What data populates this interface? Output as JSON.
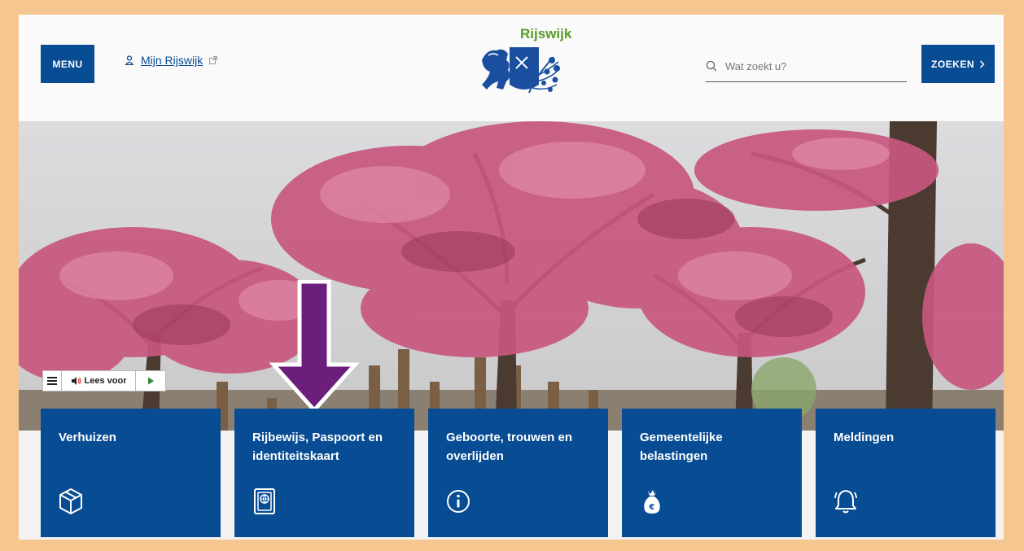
{
  "header": {
    "menu_label": "MENU",
    "mijn_label": "Mijn Rijswijk",
    "logo_text": "Rijswijk",
    "search_placeholder": "Wat zoekt u?",
    "search_button_label": "ZOEKEN"
  },
  "readspeaker": {
    "label": "Lees voor"
  },
  "tiles": [
    {
      "label": "Verhuizen",
      "icon": "box-icon"
    },
    {
      "label": "Rijbewijs, Paspoort en identiteitskaart",
      "icon": "passport-icon"
    },
    {
      "label": "Geboorte, trouwen en overlijden",
      "icon": "info-icon"
    },
    {
      "label": "Gemeentelijke belastingen",
      "icon": "money-bag-icon"
    },
    {
      "label": "Meldingen",
      "icon": "bell-icon"
    }
  ],
  "colors": {
    "brand_blue": "#084c94",
    "logo_green": "#5a9a2a",
    "frame": "#f5c68f",
    "annotation_arrow": "#6b1f7a"
  }
}
